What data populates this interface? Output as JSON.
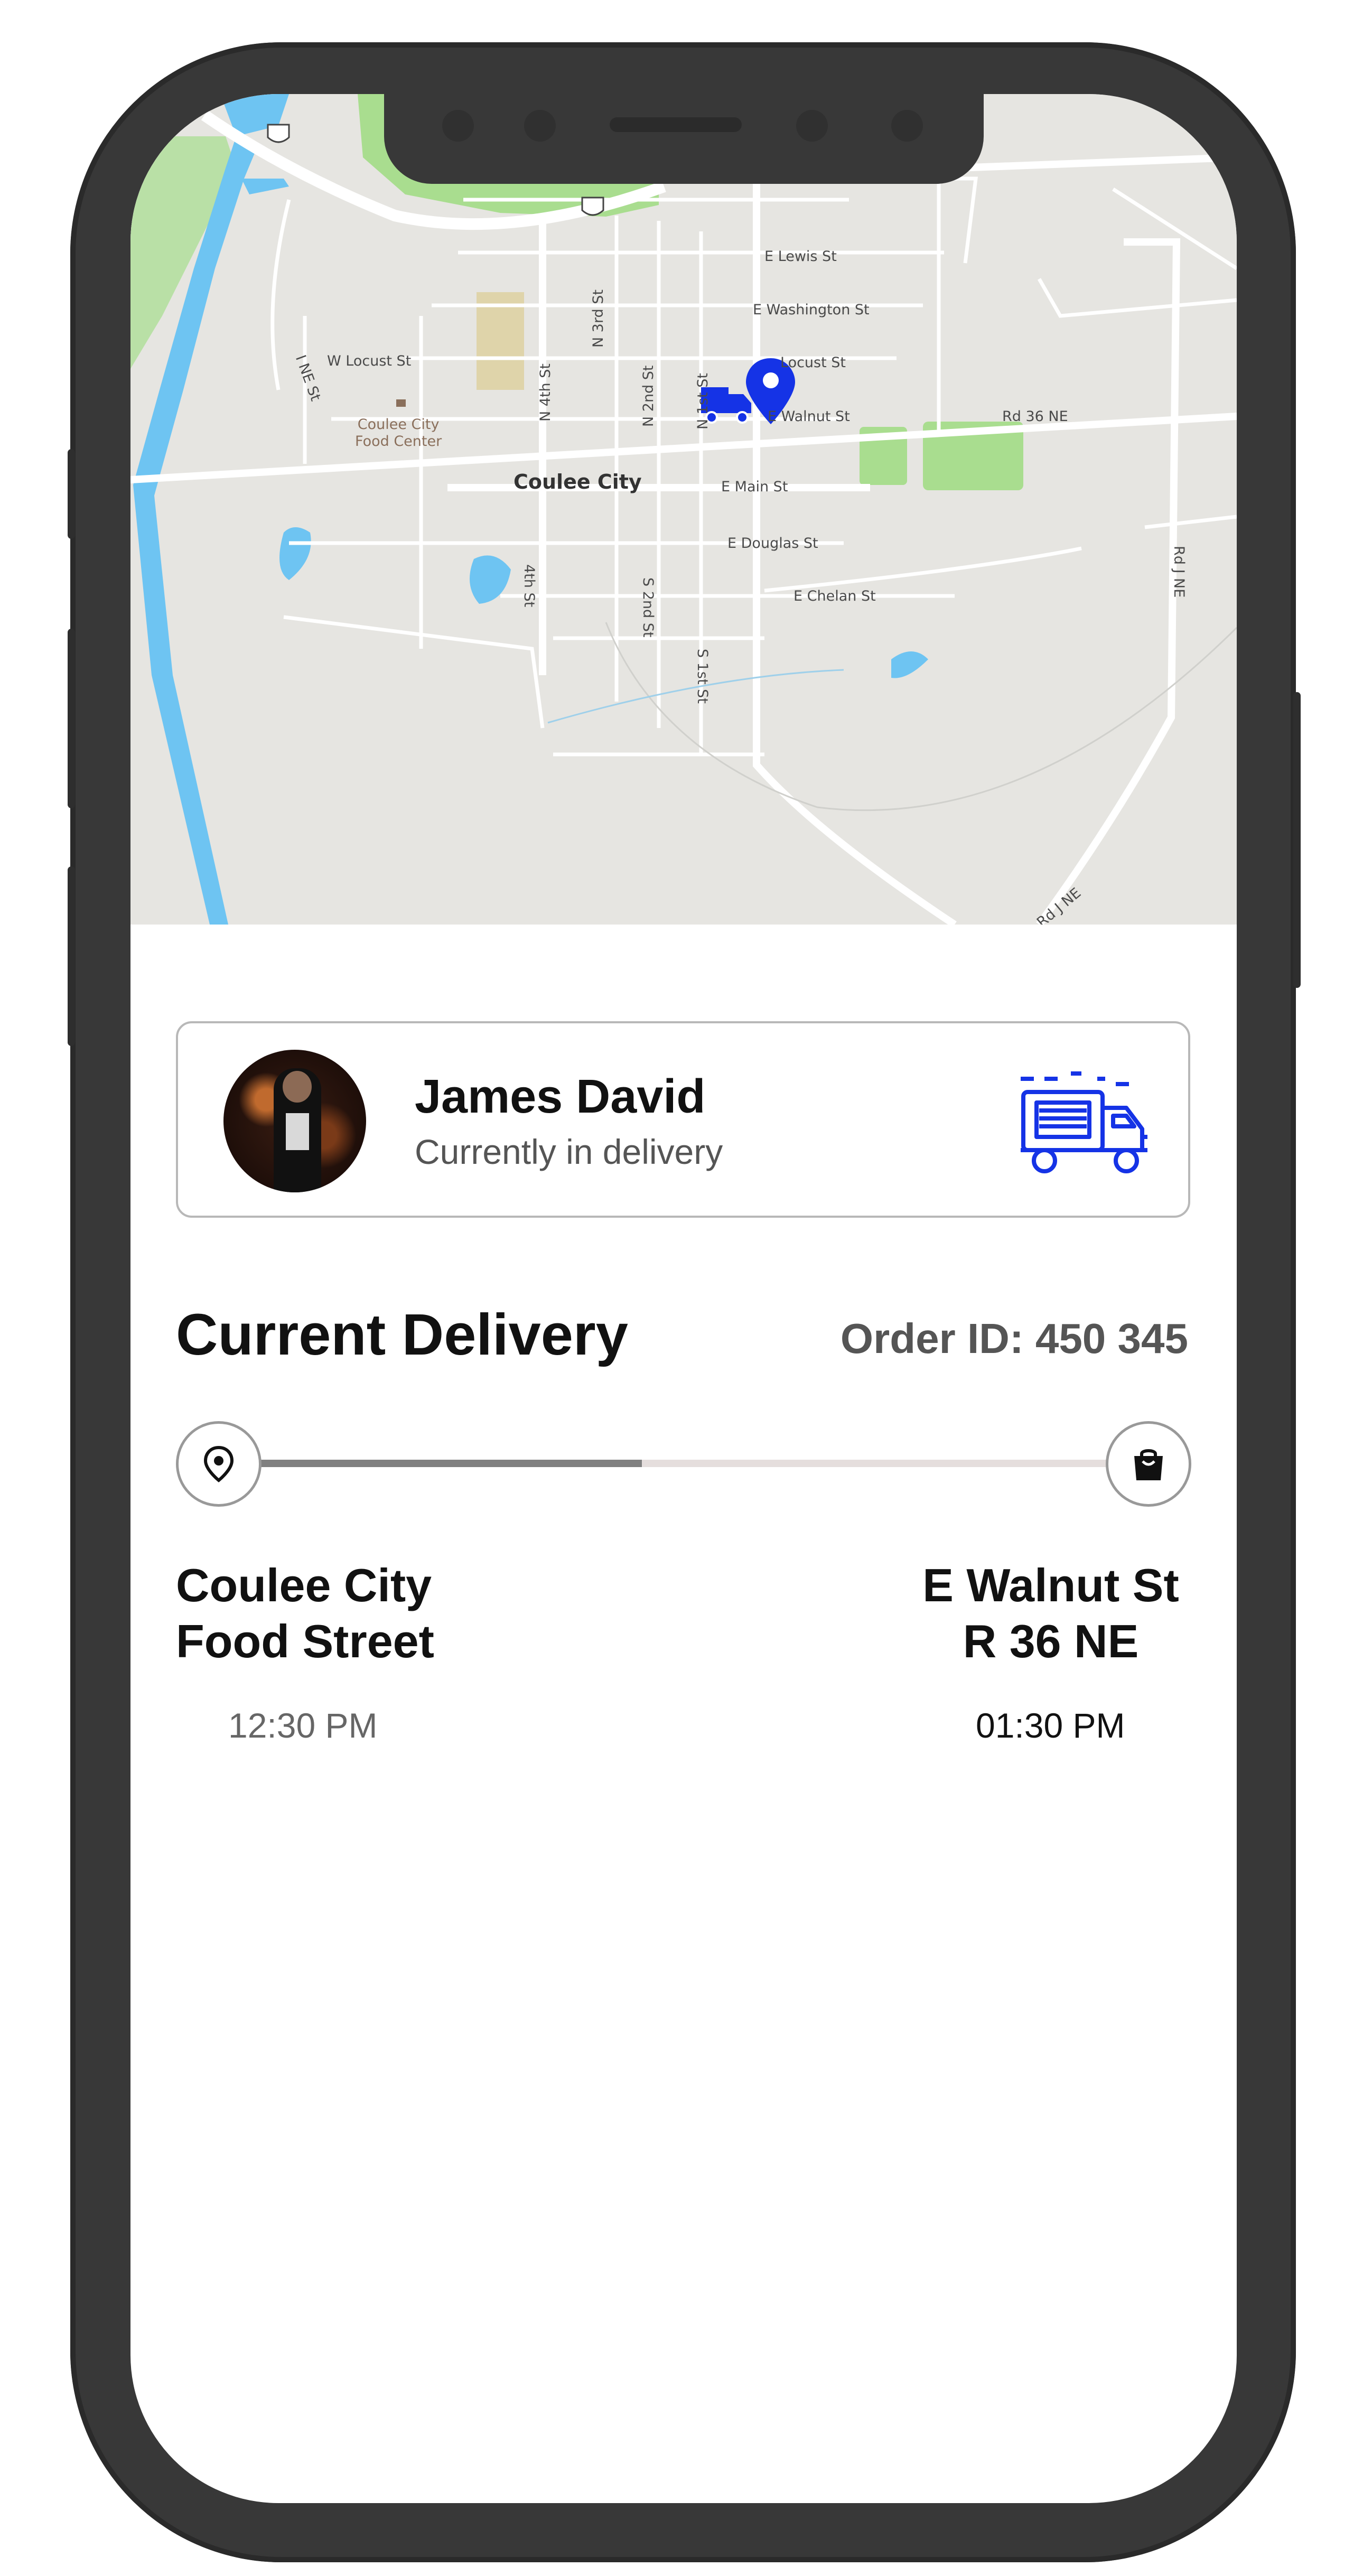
{
  "map": {
    "city_label": "Coulee City",
    "poi_label": "Coulee City\nFood Center",
    "streets": {
      "e_lewis": "E Lewis St",
      "e_washington": "E Washington St",
      "locust": "Locust St",
      "w_locust": "W Locust St",
      "e_walnut": "E Walnut St",
      "rd36": "Rd 36 NE",
      "e_main": "E Main St",
      "e_douglas": "E Douglas St",
      "e_chelan": "E Chelan St",
      "n3rd": "N 3rd St",
      "n4th": "N 4th St",
      "n2nd": "N 2nd St",
      "n1st": "N 1st St",
      "s2nd": "S 2nd St",
      "s1st": "S 1st St",
      "4th": "4th St",
      "ine": "I NE St",
      "rdj_upper": "Rd J NE",
      "rdj_lower": "Rd J NE"
    },
    "shields": [
      "2",
      "2"
    ]
  },
  "driver": {
    "name": "James David",
    "status": "Currently in delivery"
  },
  "delivery": {
    "title": "Current Delivery",
    "order_id": "Order ID: 450 345",
    "progress": 0.45,
    "origin": {
      "line1": "Coulee City",
      "line2": "Food Street",
      "time": "12:30 PM"
    },
    "destination": {
      "line1": "E Walnut St",
      "line2": "R 36 NE",
      "time": "01:30 PM"
    }
  },
  "colors": {
    "accent": "#1533e6",
    "water": "#6ec4f2",
    "park": "#a9dd8f"
  },
  "icons": {
    "truck": "truck-icon",
    "pin": "location-pin-icon",
    "bag": "shopping-bag-icon"
  }
}
